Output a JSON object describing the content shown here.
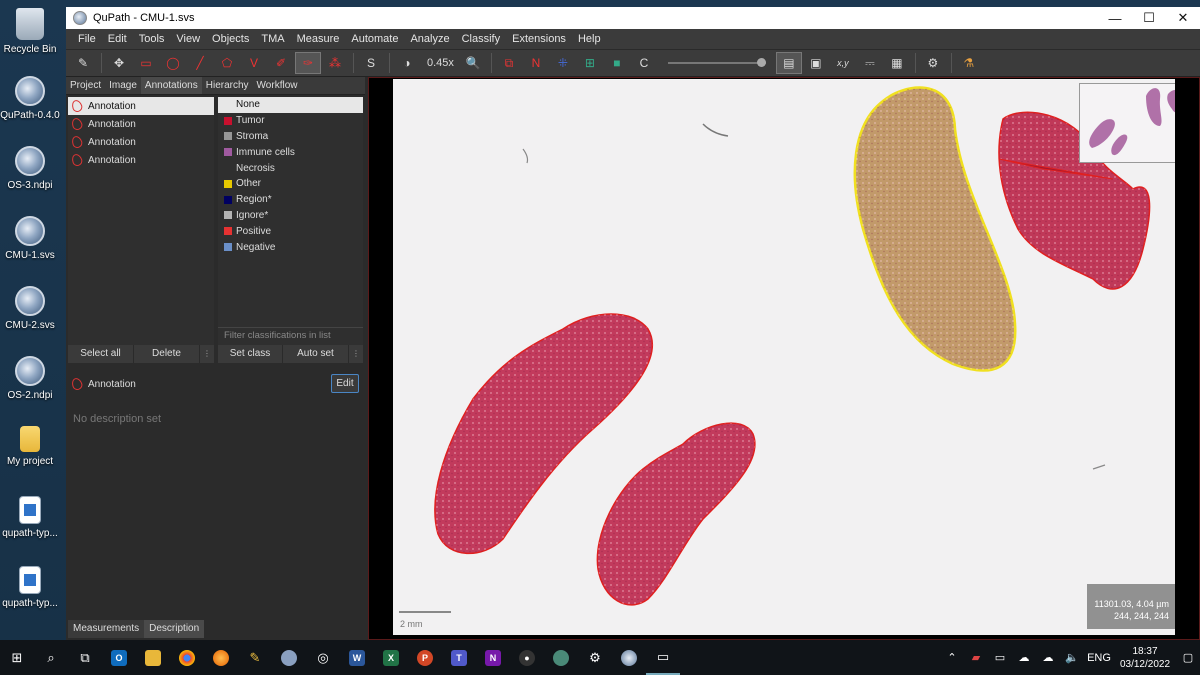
{
  "desktop": {
    "icons": [
      {
        "label": "Recycle Bin",
        "kind": "bin"
      },
      {
        "label": "QuPath-0.4.0",
        "kind": "qupath"
      },
      {
        "label": "OS-3.ndpi",
        "kind": "qupath"
      },
      {
        "label": "CMU-1.svs",
        "kind": "qupath"
      },
      {
        "label": "CMU-2.svs",
        "kind": "qupath"
      },
      {
        "label": "OS-2.ndpi",
        "kind": "qupath"
      },
      {
        "label": "My project",
        "kind": "folder"
      },
      {
        "label": "qupath-typ...",
        "kind": "image"
      },
      {
        "label": "qupath-typ...",
        "kind": "image"
      }
    ]
  },
  "window": {
    "title": "QuPath - CMU-1.svs",
    "controls": [
      "—",
      "☐",
      "✕"
    ]
  },
  "menu": [
    "File",
    "Edit",
    "Tools",
    "View",
    "Objects",
    "TMA",
    "Measure",
    "Automate",
    "Analyze",
    "Classify",
    "Extensions",
    "Help"
  ],
  "toolbar": {
    "zoom": "0.45x",
    "s_label": "S",
    "n_label": "N",
    "c_label": "C",
    "xy_label": "x,y"
  },
  "left_tabs": [
    "Project",
    "Image",
    "Annotations",
    "Hierarchy",
    "Workflow"
  ],
  "annotations": [
    "Annotation",
    "Annotation",
    "Annotation",
    "Annotation"
  ],
  "classes": [
    {
      "name": "None",
      "color": ""
    },
    {
      "name": "Tumor",
      "color": "#c8102e"
    },
    {
      "name": "Stroma",
      "color": "#969696"
    },
    {
      "name": "Immune cells",
      "color": "#a05aa0"
    },
    {
      "name": "Necrosis",
      "color": ""
    },
    {
      "name": "Other",
      "color": "#e6c800"
    },
    {
      "name": "Region*",
      "color": "#000060"
    },
    {
      "name": "Ignore*",
      "color": "#b4b4b4"
    },
    {
      "name": "Positive",
      "color": "#e63232"
    },
    {
      "name": "Negative",
      "color": "#6a8fc8"
    }
  ],
  "filter_placeholder": "Filter classifications in list",
  "buttons": {
    "select_all": "Select all",
    "delete": "Delete",
    "set_class": "Set class",
    "auto_set": "Auto set",
    "caret": "⋮",
    "edit": "Edit"
  },
  "selected_annotation": "Annotation",
  "description_placeholder": "No description set",
  "bottom_tabs": [
    "Measurements",
    "Description"
  ],
  "viewer": {
    "coords_line1": "11301.03, 4.04 µm",
    "coords_line2": "244, 244, 244",
    "scale_label": "2 mm"
  },
  "tray": {
    "lang": "ENG",
    "time": "18:37",
    "date": "03/12/2022"
  }
}
